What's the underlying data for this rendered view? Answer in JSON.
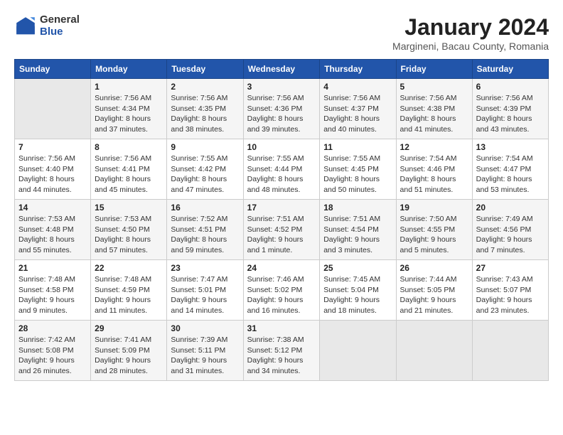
{
  "header": {
    "logo_general": "General",
    "logo_blue": "Blue",
    "title": "January 2024",
    "location": "Margineni, Bacau County, Romania"
  },
  "weekdays": [
    "Sunday",
    "Monday",
    "Tuesday",
    "Wednesday",
    "Thursday",
    "Friday",
    "Saturday"
  ],
  "weeks": [
    [
      {
        "day": "",
        "info": ""
      },
      {
        "day": "1",
        "info": "Sunrise: 7:56 AM\nSunset: 4:34 PM\nDaylight: 8 hours\nand 37 minutes."
      },
      {
        "day": "2",
        "info": "Sunrise: 7:56 AM\nSunset: 4:35 PM\nDaylight: 8 hours\nand 38 minutes."
      },
      {
        "day": "3",
        "info": "Sunrise: 7:56 AM\nSunset: 4:36 PM\nDaylight: 8 hours\nand 39 minutes."
      },
      {
        "day": "4",
        "info": "Sunrise: 7:56 AM\nSunset: 4:37 PM\nDaylight: 8 hours\nand 40 minutes."
      },
      {
        "day": "5",
        "info": "Sunrise: 7:56 AM\nSunset: 4:38 PM\nDaylight: 8 hours\nand 41 minutes."
      },
      {
        "day": "6",
        "info": "Sunrise: 7:56 AM\nSunset: 4:39 PM\nDaylight: 8 hours\nand 43 minutes."
      }
    ],
    [
      {
        "day": "7",
        "info": "Sunrise: 7:56 AM\nSunset: 4:40 PM\nDaylight: 8 hours\nand 44 minutes."
      },
      {
        "day": "8",
        "info": "Sunrise: 7:56 AM\nSunset: 4:41 PM\nDaylight: 8 hours\nand 45 minutes."
      },
      {
        "day": "9",
        "info": "Sunrise: 7:55 AM\nSunset: 4:42 PM\nDaylight: 8 hours\nand 47 minutes."
      },
      {
        "day": "10",
        "info": "Sunrise: 7:55 AM\nSunset: 4:44 PM\nDaylight: 8 hours\nand 48 minutes."
      },
      {
        "day": "11",
        "info": "Sunrise: 7:55 AM\nSunset: 4:45 PM\nDaylight: 8 hours\nand 50 minutes."
      },
      {
        "day": "12",
        "info": "Sunrise: 7:54 AM\nSunset: 4:46 PM\nDaylight: 8 hours\nand 51 minutes."
      },
      {
        "day": "13",
        "info": "Sunrise: 7:54 AM\nSunset: 4:47 PM\nDaylight: 8 hours\nand 53 minutes."
      }
    ],
    [
      {
        "day": "14",
        "info": "Sunrise: 7:53 AM\nSunset: 4:48 PM\nDaylight: 8 hours\nand 55 minutes."
      },
      {
        "day": "15",
        "info": "Sunrise: 7:53 AM\nSunset: 4:50 PM\nDaylight: 8 hours\nand 57 minutes."
      },
      {
        "day": "16",
        "info": "Sunrise: 7:52 AM\nSunset: 4:51 PM\nDaylight: 8 hours\nand 59 minutes."
      },
      {
        "day": "17",
        "info": "Sunrise: 7:51 AM\nSunset: 4:52 PM\nDaylight: 9 hours\nand 1 minute."
      },
      {
        "day": "18",
        "info": "Sunrise: 7:51 AM\nSunset: 4:54 PM\nDaylight: 9 hours\nand 3 minutes."
      },
      {
        "day": "19",
        "info": "Sunrise: 7:50 AM\nSunset: 4:55 PM\nDaylight: 9 hours\nand 5 minutes."
      },
      {
        "day": "20",
        "info": "Sunrise: 7:49 AM\nSunset: 4:56 PM\nDaylight: 9 hours\nand 7 minutes."
      }
    ],
    [
      {
        "day": "21",
        "info": "Sunrise: 7:48 AM\nSunset: 4:58 PM\nDaylight: 9 hours\nand 9 minutes."
      },
      {
        "day": "22",
        "info": "Sunrise: 7:48 AM\nSunset: 4:59 PM\nDaylight: 9 hours\nand 11 minutes."
      },
      {
        "day": "23",
        "info": "Sunrise: 7:47 AM\nSunset: 5:01 PM\nDaylight: 9 hours\nand 14 minutes."
      },
      {
        "day": "24",
        "info": "Sunrise: 7:46 AM\nSunset: 5:02 PM\nDaylight: 9 hours\nand 16 minutes."
      },
      {
        "day": "25",
        "info": "Sunrise: 7:45 AM\nSunset: 5:04 PM\nDaylight: 9 hours\nand 18 minutes."
      },
      {
        "day": "26",
        "info": "Sunrise: 7:44 AM\nSunset: 5:05 PM\nDaylight: 9 hours\nand 21 minutes."
      },
      {
        "day": "27",
        "info": "Sunrise: 7:43 AM\nSunset: 5:07 PM\nDaylight: 9 hours\nand 23 minutes."
      }
    ],
    [
      {
        "day": "28",
        "info": "Sunrise: 7:42 AM\nSunset: 5:08 PM\nDaylight: 9 hours\nand 26 minutes."
      },
      {
        "day": "29",
        "info": "Sunrise: 7:41 AM\nSunset: 5:09 PM\nDaylight: 9 hours\nand 28 minutes."
      },
      {
        "day": "30",
        "info": "Sunrise: 7:39 AM\nSunset: 5:11 PM\nDaylight: 9 hours\nand 31 minutes."
      },
      {
        "day": "31",
        "info": "Sunrise: 7:38 AM\nSunset: 5:12 PM\nDaylight: 9 hours\nand 34 minutes."
      },
      {
        "day": "",
        "info": ""
      },
      {
        "day": "",
        "info": ""
      },
      {
        "day": "",
        "info": ""
      }
    ]
  ]
}
